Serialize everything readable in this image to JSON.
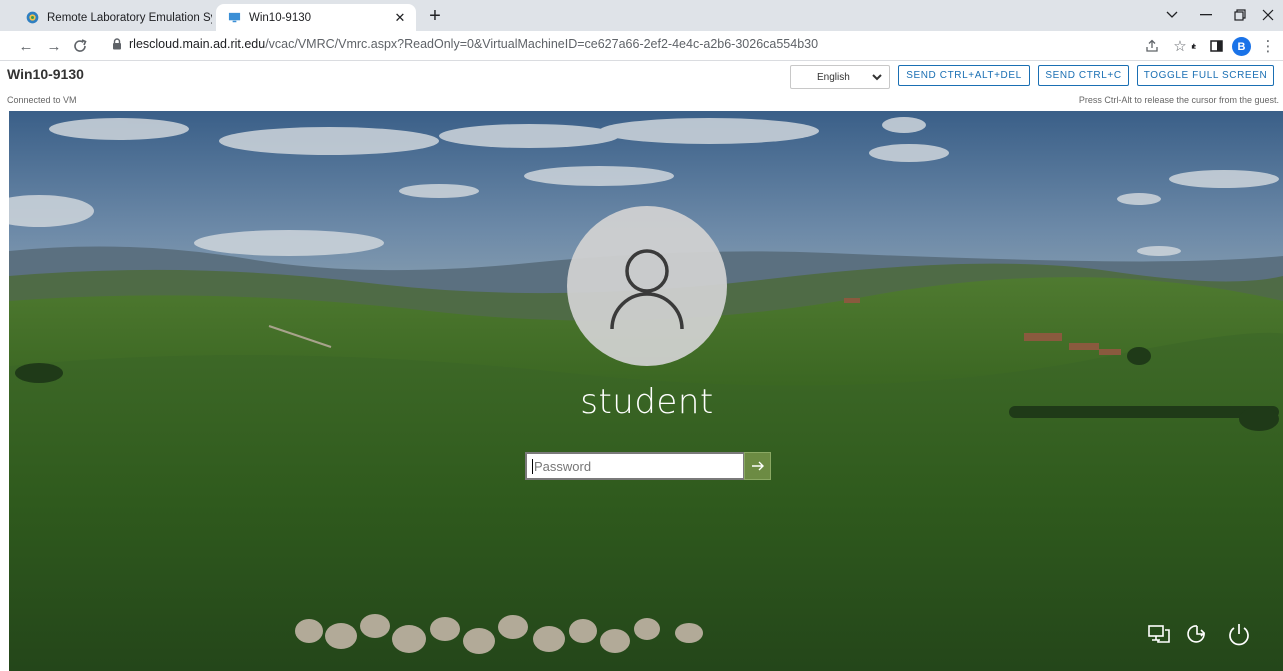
{
  "browser": {
    "tabs": [
      {
        "title": "Remote Laboratory Emulation Sy",
        "icon": "rles-globe-icon",
        "active": false
      },
      {
        "title": "Win10-9130",
        "icon": "monitor-icon",
        "active": true
      }
    ],
    "new_tab_label": "+",
    "address": {
      "domain": "rlescloud.main.ad.rit.edu",
      "path": "/vcac/VMRC/Vmrc.aspx?ReadOnly=0&VirtualMachineID=ce627a66-2ef2-4e4c-a2b6-3026ca554b30"
    },
    "profile_initial": "B"
  },
  "vmrc": {
    "title": "Win10-9130",
    "status": "Connected to VM",
    "language": "English",
    "buttons": {
      "ctrl_alt_del": "SEND CTRL+ALT+DEL",
      "ctrl_c": "SEND CTRL+C",
      "fullscreen": "TOGGLE FULL SCREEN"
    },
    "hint": "Press Ctrl-Alt to release the cursor from the guest."
  },
  "lockscreen": {
    "username": "student",
    "password_placeholder": "Password",
    "tray_icons": [
      "network-icon",
      "ease-of-access-icon",
      "power-icon"
    ]
  },
  "colors": {
    "accent": "#1a6fb3",
    "submit_green": "#6c8b43",
    "profile_blue": "#1a73e8"
  }
}
